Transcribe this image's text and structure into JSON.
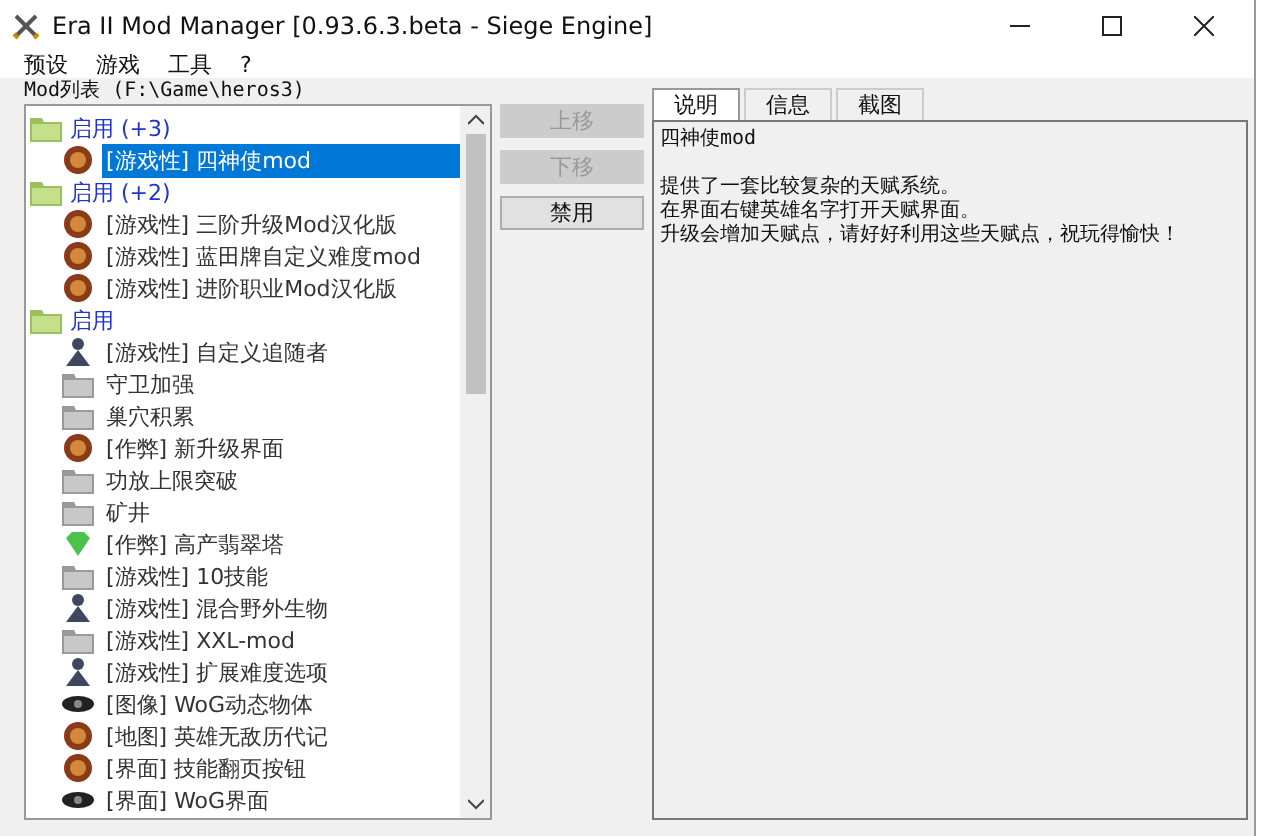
{
  "window": {
    "title": "Era II Mod Manager [0.93.6.3.beta - Siege Engine]"
  },
  "menu": [
    "预设",
    "游戏",
    "工具",
    "?"
  ],
  "mod_list": {
    "label": "Mod列表 (F:\\Game\\heros3)",
    "groups": [
      {
        "label": "启用 (+3)",
        "items": [
          {
            "text": "[游戏性] 四神使mod",
            "kind": "emblem",
            "selected": true
          }
        ]
      },
      {
        "label": "启用 (+2)",
        "items": [
          {
            "text": "[游戏性] 三阶升级Mod汉化版",
            "kind": "emblem",
            "selected": false
          },
          {
            "text": "[游戏性] 蓝田牌自定义难度mod",
            "kind": "emblem",
            "selected": false
          },
          {
            "text": "[游戏性] 进阶职业Mod汉化版",
            "kind": "emblem",
            "selected": false
          }
        ]
      },
      {
        "label": "启用",
        "items": [
          {
            "text": "[游戏性] 自定义追随者",
            "kind": "figure",
            "selected": false
          },
          {
            "text": "守卫加强",
            "kind": "folder",
            "selected": false
          },
          {
            "text": "巢穴积累",
            "kind": "folder",
            "selected": false
          },
          {
            "text": "[作弊] 新升级界面",
            "kind": "emblem",
            "selected": false
          },
          {
            "text": "功放上限突破",
            "kind": "folder",
            "selected": false
          },
          {
            "text": "矿井",
            "kind": "folder",
            "selected": false
          },
          {
            "text": "[作弊] 高产翡翠塔",
            "kind": "gem",
            "selected": false
          },
          {
            "text": "[游戏性] 10技能",
            "kind": "folder",
            "selected": false
          },
          {
            "text": "[游戏性] 混合野外生物",
            "kind": "figure",
            "selected": false
          },
          {
            "text": "[游戏性] XXL-mod",
            "kind": "folder",
            "selected": false
          },
          {
            "text": "[游戏性] 扩展难度选项",
            "kind": "figure",
            "selected": false
          },
          {
            "text": "[图像] WoG动态物体",
            "kind": "eye",
            "selected": false
          },
          {
            "text": "[地图] 英雄无敌历代记",
            "kind": "emblem",
            "selected": false
          },
          {
            "text": "[界面] 技能翻页按钮",
            "kind": "emblem",
            "selected": false
          },
          {
            "text": "[界面] WoG界面",
            "kind": "eye",
            "selected": false
          }
        ]
      }
    ]
  },
  "buttons": [
    {
      "label": "上移",
      "disabled": true
    },
    {
      "label": "下移",
      "disabled": true
    },
    {
      "label": "禁用",
      "disabled": false
    }
  ],
  "tabs": [
    {
      "label": "说明",
      "selected": true
    },
    {
      "label": "信息",
      "selected": false
    },
    {
      "label": "截图",
      "selected": false
    }
  ],
  "description": {
    "title": "四神使mod",
    "lines": [
      "提供了一套比较复杂的天赋系统。",
      "在界面右键英雄名字打开天赋界面。",
      "升级会增加天赋点，请好好利用这些天赋点，祝玩得愉快！"
    ]
  }
}
